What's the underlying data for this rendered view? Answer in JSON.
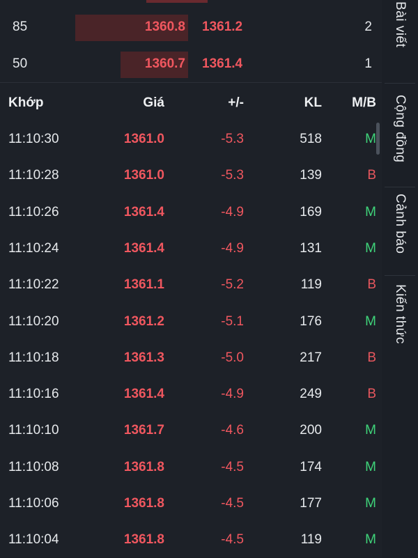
{
  "depth": [
    {
      "volume": "85",
      "bid": "1360.8",
      "ask": "1361.2",
      "count": "2",
      "bar_fraction": 0.45
    },
    {
      "volume": "50",
      "bid": "1360.7",
      "ask": "1361.4",
      "count": "1",
      "bar_fraction": 0.27
    }
  ],
  "trades": {
    "headers": {
      "time": "Khớp",
      "price": "Giá",
      "change": "+/-",
      "volume": "KL",
      "side": "M/B"
    },
    "rows": [
      {
        "time": "11:10:30",
        "price": "1361.0",
        "change": "-5.3",
        "volume": "518",
        "side": "M"
      },
      {
        "time": "11:10:28",
        "price": "1361.0",
        "change": "-5.3",
        "volume": "139",
        "side": "B"
      },
      {
        "time": "11:10:26",
        "price": "1361.4",
        "change": "-4.9",
        "volume": "169",
        "side": "M"
      },
      {
        "time": "11:10:24",
        "price": "1361.4",
        "change": "-4.9",
        "volume": "131",
        "side": "M"
      },
      {
        "time": "11:10:22",
        "price": "1361.1",
        "change": "-5.2",
        "volume": "119",
        "side": "B"
      },
      {
        "time": "11:10:20",
        "price": "1361.2",
        "change": "-5.1",
        "volume": "176",
        "side": "M"
      },
      {
        "time": "11:10:18",
        "price": "1361.3",
        "change": "-5.0",
        "volume": "217",
        "side": "B"
      },
      {
        "time": "11:10:16",
        "price": "1361.4",
        "change": "-4.9",
        "volume": "249",
        "side": "B"
      },
      {
        "time": "11:10:10",
        "price": "1361.7",
        "change": "-4.6",
        "volume": "200",
        "side": "M"
      },
      {
        "time": "11:10:08",
        "price": "1361.8",
        "change": "-4.5",
        "volume": "174",
        "side": "M"
      },
      {
        "time": "11:10:06",
        "price": "1361.8",
        "change": "-4.5",
        "volume": "177",
        "side": "M"
      },
      {
        "time": "11:10:04",
        "price": "1361.8",
        "change": "-4.5",
        "volume": "119",
        "side": "M"
      }
    ]
  },
  "sidebar": {
    "tabs": [
      "Bài viết",
      "Cộng đồng",
      "Cảnh báo",
      "Kiến thức"
    ]
  },
  "colors": {
    "down": "#f0575f",
    "buy": "#3fd47a",
    "sell": "#e8575e",
    "bid_bar": "#4a2428"
  }
}
